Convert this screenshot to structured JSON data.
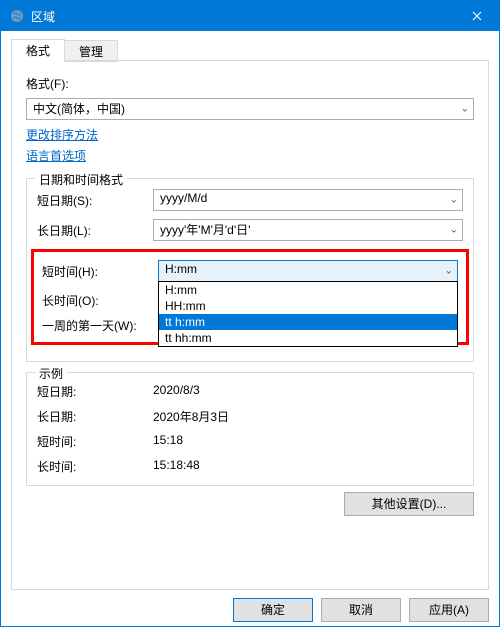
{
  "titlebar": {
    "title": "区域"
  },
  "tabs": {
    "format": "格式",
    "admin": "管理"
  },
  "format_section": {
    "label": "格式(F):",
    "selected": "中文(简体，中国)"
  },
  "links": {
    "sort_method": "更改排序方法",
    "language_prefs": "语言首选项"
  },
  "datetime_legend": "日期和时间格式",
  "short_date": {
    "label": "短日期(S):",
    "value": "yyyy/M/d"
  },
  "long_date": {
    "label": "长日期(L):",
    "value": "yyyy'年'M'月'd'日'"
  },
  "short_time": {
    "label": "短时间(H):",
    "value": "H:mm",
    "options": [
      "H:mm",
      "HH:mm",
      "tt h:mm",
      "tt hh:mm"
    ],
    "selected_index": 2
  },
  "long_time": {
    "label": "长时间(O):"
  },
  "first_day": {
    "label": "一周的第一天(W):"
  },
  "examples": {
    "legend": "示例",
    "short_date": {
      "label": "短日期:",
      "value": "2020/8/3"
    },
    "long_date": {
      "label": "长日期:",
      "value": "2020年8月3日"
    },
    "short_time": {
      "label": "短时间:",
      "value": "15:18"
    },
    "long_time": {
      "label": "长时间:",
      "value": "15:18:48"
    }
  },
  "buttons": {
    "other_settings": "其他设置(D)...",
    "ok": "确定",
    "cancel": "取消",
    "apply": "应用(A)"
  }
}
